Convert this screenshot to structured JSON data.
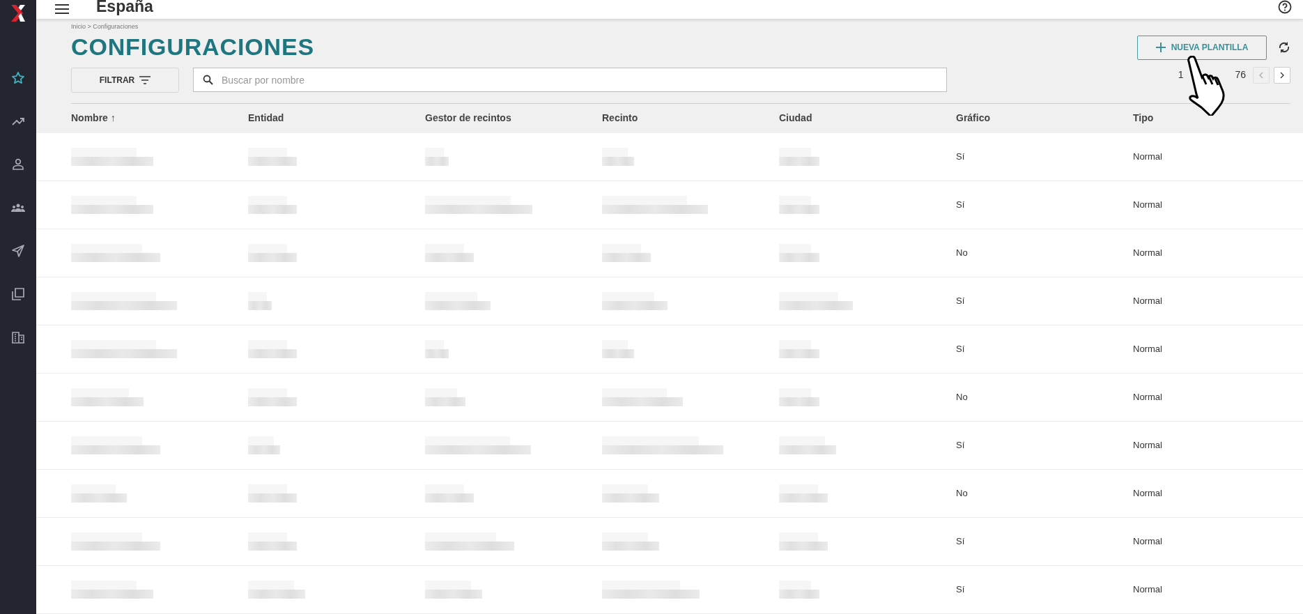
{
  "header": {
    "title": "España"
  },
  "breadcrumb": "Inicio > Configuraciones",
  "page_title": "CONFIGURACIONES",
  "new_button": "NUEVA PLANTILLA",
  "filter_button": "FILTRAR",
  "search": {
    "placeholder": "Buscar por nombre"
  },
  "pagination": {
    "start": "1",
    "end": "76"
  },
  "sidebar": {
    "items": [
      {
        "selected": true
      },
      {
        "selected": false
      },
      {
        "selected": false
      },
      {
        "selected": false
      },
      {
        "selected": false
      },
      {
        "selected": false
      },
      {
        "selected": false
      }
    ]
  },
  "table": {
    "columns": [
      "Nombre ↑",
      "Entidad",
      "Gestor de recintos",
      "Recinto",
      "Ciudad",
      "Gráfico",
      "Tipo"
    ],
    "rows": [
      {
        "grafico": "Sí",
        "tipo": "Normal"
      },
      {
        "grafico": "Sí",
        "tipo": "Normal"
      },
      {
        "grafico": "No",
        "tipo": "Normal"
      },
      {
        "grafico": "Sí",
        "tipo": "Normal"
      },
      {
        "grafico": "Sí",
        "tipo": "Normal"
      },
      {
        "grafico": "No",
        "tipo": "Normal"
      },
      {
        "grafico": "Sí",
        "tipo": "Normal"
      },
      {
        "grafico": "No",
        "tipo": "Normal"
      },
      {
        "grafico": "Sí",
        "tipo": "Normal"
      },
      {
        "grafico": "Sí",
        "tipo": "Normal"
      }
    ]
  }
}
